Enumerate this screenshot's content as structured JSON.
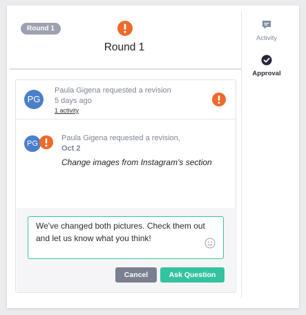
{
  "sidebar": {
    "activity_label": "Activity",
    "approval_label": "Approval"
  },
  "round": {
    "badge": "Round 1",
    "title": "Round 1"
  },
  "revision": {
    "avatar_initials": "PG",
    "summary": "Paula Gigena requested a revision",
    "time_ago": "5 days ago",
    "activity_link": "1 activity"
  },
  "message": {
    "avatar_initials": "PG",
    "header": "Paula Gigena requested a revision,",
    "date": "Oct 2",
    "body": "Change images from Instagram's section"
  },
  "reply": {
    "text": "We've changed both pictures. Check them out and let us know what you think!",
    "cancel_label": "Cancel",
    "submit_label": "Ask Question"
  },
  "colors": {
    "alert_orange": "#ee6a2a",
    "accent_teal": "#35c29f",
    "avatar_blue": "#4a7fc9"
  }
}
